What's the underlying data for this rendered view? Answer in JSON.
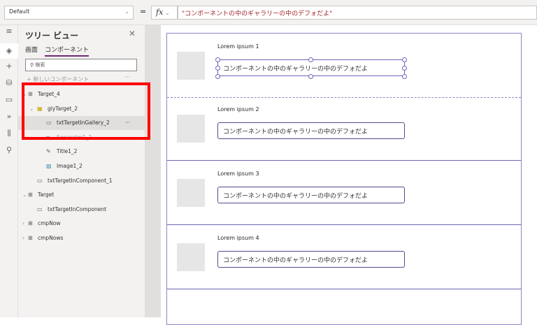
{
  "formula_bar": {
    "property": "Default",
    "equals": "=",
    "fx": "fx",
    "formula": "\"コンポーネントの中のギャラリーの中のデフォだよ\""
  },
  "tree": {
    "title": "ツリー ビュー",
    "tabs": [
      "画面",
      "コンポーネント"
    ],
    "search_placeholder": "検索",
    "new_component": "新しいコンポーネント",
    "more": "···",
    "items": [
      {
        "label": "Target_4"
      },
      {
        "label": "glyTarget_2"
      },
      {
        "label": "txtTargetInGallery_2"
      },
      {
        "label": "Separator1_2"
      },
      {
        "label": "Title1_2"
      },
      {
        "label": "Image1_2"
      },
      {
        "label": "txtTargetInComponent_1"
      },
      {
        "label": "Target"
      },
      {
        "label": "txtTargetInComponent"
      },
      {
        "label": "cmpNow"
      },
      {
        "label": "cmpNows"
      }
    ]
  },
  "gallery": {
    "rows": [
      {
        "title": "Lorem ipsum 1",
        "text": "コンポーネントの中のギャラリーの中のデフォだよ"
      },
      {
        "title": "Lorem ipsum 2",
        "text": "コンポーネントの中のギャラリーの中のデフォだよ"
      },
      {
        "title": "Lorem ipsum 3",
        "text": "コンポーネントの中のギャラリーの中のデフォだよ"
      },
      {
        "title": "Lorem ipsum 4",
        "text": "コンポーネントの中のギャラリーの中のデフォだよ"
      }
    ]
  }
}
